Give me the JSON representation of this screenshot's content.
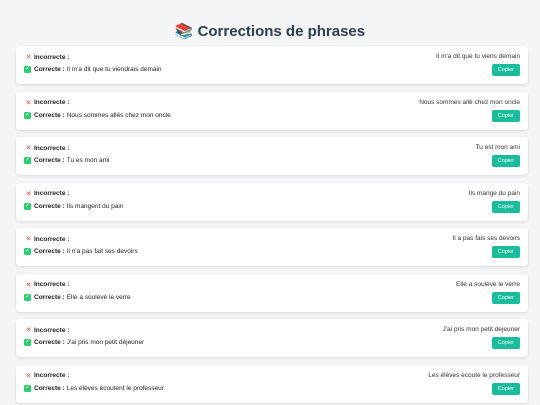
{
  "header": {
    "icon": "books-icon",
    "title": "Corrections de phrases"
  },
  "labels": {
    "incorrect": "Incorrecte :",
    "correct": "Correcte :",
    "copy": "Copier"
  },
  "colors": {
    "accent": "#1abc9c",
    "incorrect_mark": "#e74c3c",
    "correct_mark": "#2ecc71"
  },
  "items": [
    {
      "incorrect": "Il m'a dit que tu viens demain",
      "correct": "Il m'a dit que tu viendrais demain"
    },
    {
      "incorrect": "Nous sommes allé chez mon oncle",
      "correct": "Nous sommes allés chez mon oncle"
    },
    {
      "incorrect": "Tu est mon ami",
      "correct": "Tu es mon ami"
    },
    {
      "incorrect": "Ils mange du pain",
      "correct": "Ils mangent du pain"
    },
    {
      "incorrect": "Il a pas fais ses devoirs",
      "correct": "Il n'a pas fait ses devoirs"
    },
    {
      "incorrect": "Elle a soulève le verre",
      "correct": "Elle a soulevé le verre"
    },
    {
      "incorrect": "J'ai pris mon petit dejeuner",
      "correct": "J'ai pris mon petit déjeuner"
    },
    {
      "incorrect": "Les élèves ecoute le professeur",
      "correct": "Les élèves écoutent le professeur"
    }
  ]
}
